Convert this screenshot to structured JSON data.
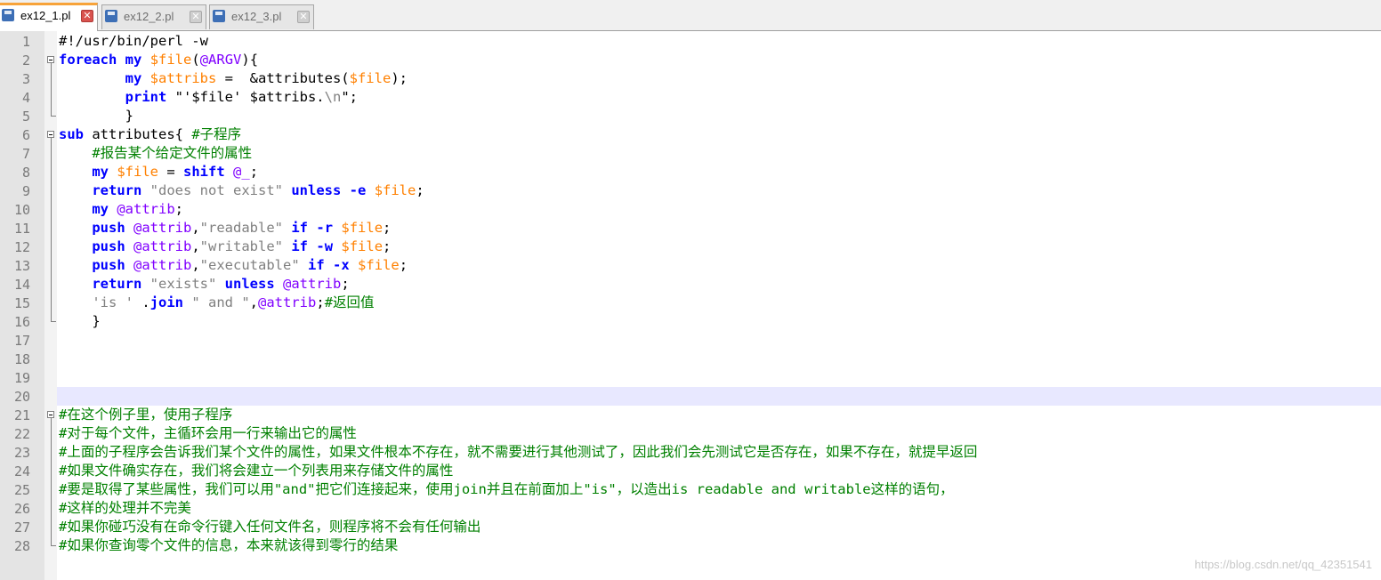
{
  "tabs": [
    {
      "name": "ex12_1.pl",
      "active": true
    },
    {
      "name": "ex12_2.pl",
      "active": false
    },
    {
      "name": "ex12_3.pl",
      "active": false
    }
  ],
  "tab_close_glyph": "✕",
  "current_line": 20,
  "colors": {
    "keyword": "#0000ff",
    "scalar": "#ff8000",
    "array": "#8000ff",
    "string": "#808080",
    "comment": "#008000",
    "current_line_bg": "#e8e8ff",
    "active_tab_accent": "#f7a33a"
  },
  "lines": [
    [
      [
        "plain",
        "#!/usr/bin/perl -w"
      ]
    ],
    [
      [
        "kw",
        "foreach"
      ],
      [
        "plain",
        " "
      ],
      [
        "kw",
        "my"
      ],
      [
        "plain",
        " "
      ],
      [
        "var",
        "$file"
      ],
      [
        "plain",
        "("
      ],
      [
        "arr",
        "@ARGV"
      ],
      [
        "plain",
        "){"
      ]
    ],
    [
      [
        "plain",
        "        "
      ],
      [
        "kw",
        "my"
      ],
      [
        "plain",
        " "
      ],
      [
        "var",
        "$attribs"
      ],
      [
        "plain",
        " =  &attributes("
      ],
      [
        "var",
        "$file"
      ],
      [
        "plain",
        ");"
      ]
    ],
    [
      [
        "plain",
        "        "
      ],
      [
        "kw",
        "print"
      ],
      [
        "plain",
        " \"'$file' $attribs."
      ],
      [
        "str",
        "\\n"
      ],
      [
        "plain",
        "\";"
      ]
    ],
    [
      [
        "plain",
        "        }"
      ]
    ],
    [
      [
        "kw",
        "sub"
      ],
      [
        "plain",
        " attributes{ "
      ],
      [
        "cmt",
        "#子程序"
      ]
    ],
    [
      [
        "plain",
        "    "
      ],
      [
        "cmt",
        "#报告某个给定文件的属性"
      ]
    ],
    [
      [
        "plain",
        "    "
      ],
      [
        "kw",
        "my"
      ],
      [
        "plain",
        " "
      ],
      [
        "var",
        "$file"
      ],
      [
        "plain",
        " = "
      ],
      [
        "kw",
        "shift"
      ],
      [
        "plain",
        " "
      ],
      [
        "arr",
        "@_"
      ],
      [
        "plain",
        ";"
      ]
    ],
    [
      [
        "plain",
        "    "
      ],
      [
        "kw",
        "return"
      ],
      [
        "plain",
        " "
      ],
      [
        "str",
        "\"does not exist\""
      ],
      [
        "plain",
        " "
      ],
      [
        "kw",
        "unless"
      ],
      [
        "plain",
        " "
      ],
      [
        "kw",
        "-e"
      ],
      [
        "plain",
        " "
      ],
      [
        "var",
        "$file"
      ],
      [
        "plain",
        ";"
      ]
    ],
    [
      [
        "plain",
        "    "
      ],
      [
        "kw",
        "my"
      ],
      [
        "plain",
        " "
      ],
      [
        "arr",
        "@attrib"
      ],
      [
        "plain",
        ";"
      ]
    ],
    [
      [
        "plain",
        "    "
      ],
      [
        "kw",
        "push"
      ],
      [
        "plain",
        " "
      ],
      [
        "arr",
        "@attrib"
      ],
      [
        "plain",
        ","
      ],
      [
        "str",
        "\"readable\""
      ],
      [
        "plain",
        " "
      ],
      [
        "kw",
        "if"
      ],
      [
        "plain",
        " "
      ],
      [
        "kw",
        "-r"
      ],
      [
        "plain",
        " "
      ],
      [
        "var",
        "$file"
      ],
      [
        "plain",
        ";"
      ]
    ],
    [
      [
        "plain",
        "    "
      ],
      [
        "kw",
        "push"
      ],
      [
        "plain",
        " "
      ],
      [
        "arr",
        "@attrib"
      ],
      [
        "plain",
        ","
      ],
      [
        "str",
        "\"writable\""
      ],
      [
        "plain",
        " "
      ],
      [
        "kw",
        "if"
      ],
      [
        "plain",
        " "
      ],
      [
        "kw",
        "-w"
      ],
      [
        "plain",
        " "
      ],
      [
        "var",
        "$file"
      ],
      [
        "plain",
        ";"
      ]
    ],
    [
      [
        "plain",
        "    "
      ],
      [
        "kw",
        "push"
      ],
      [
        "plain",
        " "
      ],
      [
        "arr",
        "@attrib"
      ],
      [
        "plain",
        ","
      ],
      [
        "str",
        "\"executable\""
      ],
      [
        "plain",
        " "
      ],
      [
        "kw",
        "if"
      ],
      [
        "plain",
        " "
      ],
      [
        "kw",
        "-x"
      ],
      [
        "plain",
        " "
      ],
      [
        "var",
        "$file"
      ],
      [
        "plain",
        ";"
      ]
    ],
    [
      [
        "plain",
        "    "
      ],
      [
        "kw",
        "return"
      ],
      [
        "plain",
        " "
      ],
      [
        "str",
        "\"exists\""
      ],
      [
        "plain",
        " "
      ],
      [
        "kw",
        "unless"
      ],
      [
        "plain",
        " "
      ],
      [
        "arr",
        "@attrib"
      ],
      [
        "plain",
        ";"
      ]
    ],
    [
      [
        "plain",
        "    "
      ],
      [
        "str",
        "'is '"
      ],
      [
        "plain",
        " ."
      ],
      [
        "kw",
        "join"
      ],
      [
        "plain",
        " "
      ],
      [
        "str",
        "\" and \""
      ],
      [
        "plain",
        ","
      ],
      [
        "arr",
        "@attrib"
      ],
      [
        "plain",
        ";"
      ],
      [
        "cmt",
        "#返回值"
      ]
    ],
    [
      [
        "plain",
        "    }"
      ]
    ],
    [],
    [],
    [],
    [],
    [
      [
        "cmt",
        "#在这个例子里，使用子程序"
      ]
    ],
    [
      [
        "cmt",
        "#对于每个文件，主循环会用一行来输出它的属性"
      ]
    ],
    [
      [
        "cmt",
        "#上面的子程序会告诉我们某个文件的属性，如果文件根本不存在，就不需要进行其他测试了，因此我们会先测试它是否存在，如果不存在，就提早返回"
      ]
    ],
    [
      [
        "cmt",
        "#如果文件确实存在，我们将会建立一个列表用来存储文件的属性"
      ]
    ],
    [
      [
        "cmt",
        "#要是取得了某些属性，我们可以用\"and\"把它们连接起来，使用join并且在前面加上\"is\"，以造出is readable and writable这样的语句，"
      ]
    ],
    [
      [
        "cmt",
        "#这样的处理并不完美"
      ]
    ],
    [
      [
        "cmt",
        "#如果你碰巧没有在命令行键入任何文件名，则程序将不会有任何输出"
      ]
    ],
    [
      [
        "cmt",
        "#如果你查询零个文件的信息，本来就该得到零行的结果"
      ]
    ]
  ],
  "watermark": "https://blog.csdn.net/qq_42351541"
}
